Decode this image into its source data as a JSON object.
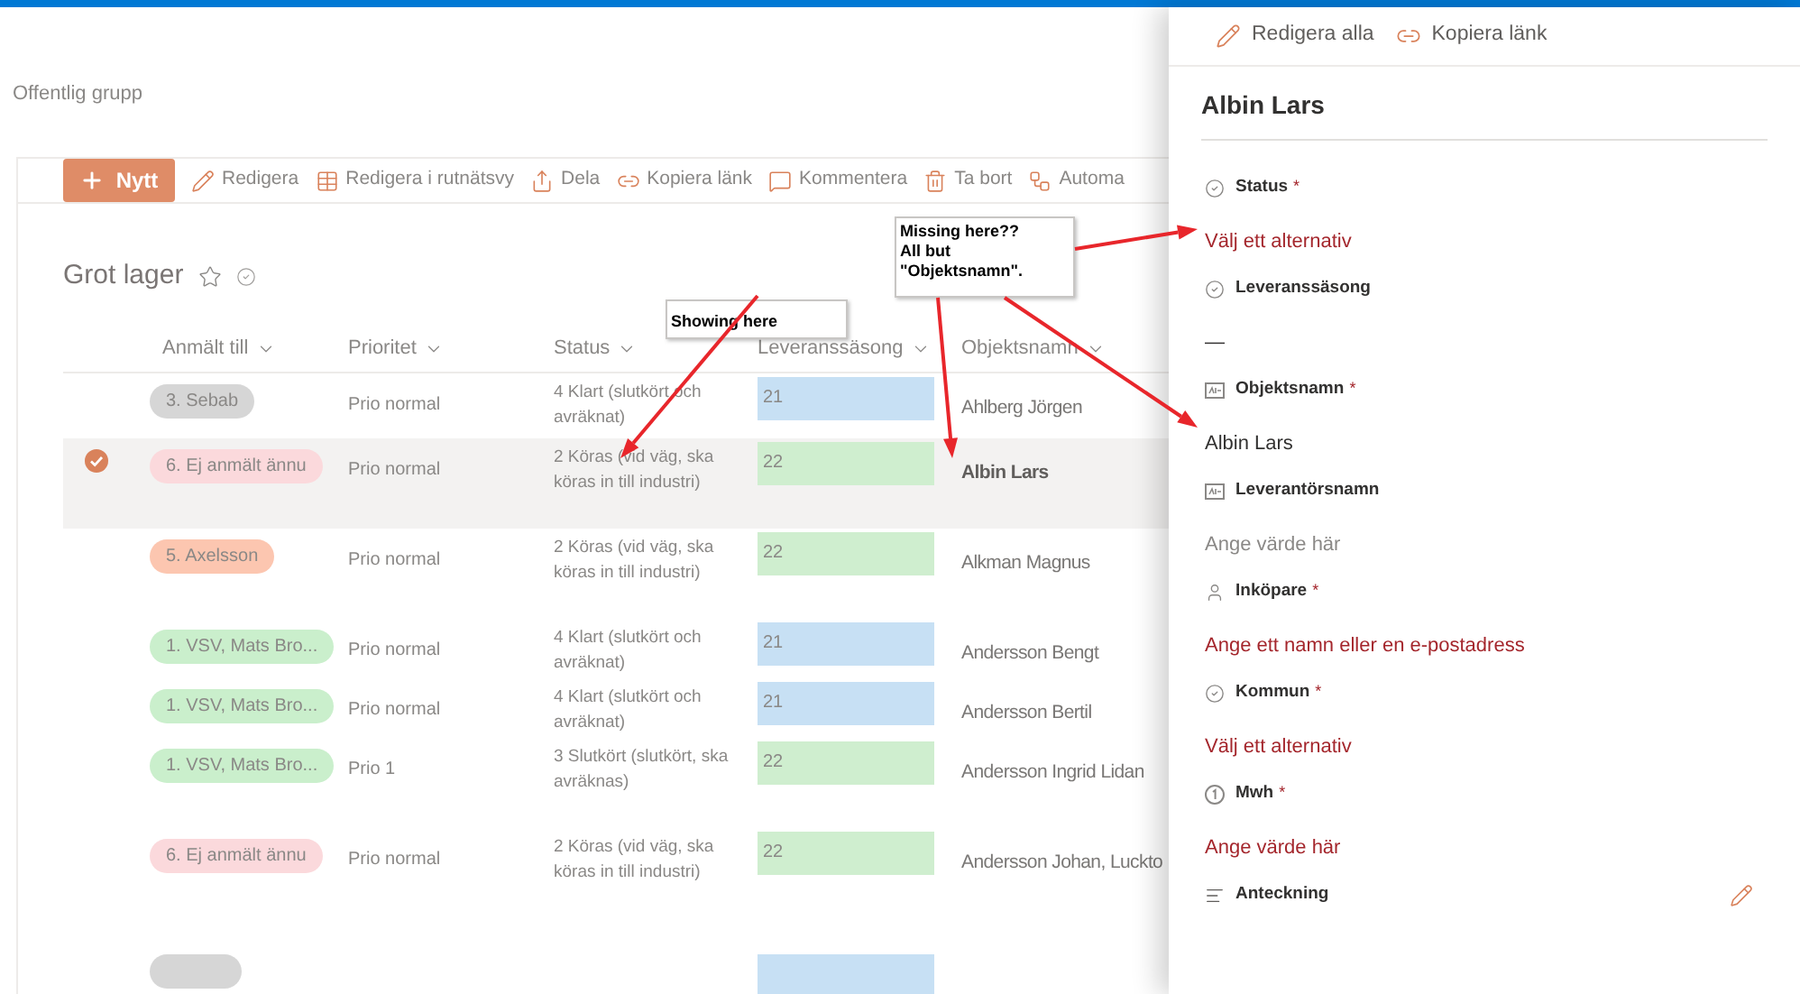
{
  "header": {
    "group_label": "Offentlig grupp"
  },
  "toolbar": {
    "new_button": {
      "label": "Nytt"
    },
    "items": [
      {
        "label": "Redigera",
        "kind": "pencil"
      },
      {
        "label": "Redigera i rutnätsvy",
        "kind": "grid"
      },
      {
        "label": "Dela",
        "kind": "share"
      },
      {
        "label": "Kopiera länk",
        "kind": "link"
      },
      {
        "label": "Kommentera",
        "kind": "comment"
      },
      {
        "label": "Ta bort",
        "kind": "trash"
      },
      {
        "label": "Automa",
        "kind": "flow"
      }
    ]
  },
  "list": {
    "title": "Grot lager",
    "columns": [
      "Anmält till",
      "Prioritet",
      "Status",
      "Leveranssäsong",
      "Objektsnamn"
    ],
    "rows": [
      {
        "selected": false,
        "assignee": {
          "label": "3. Sebab",
          "color": "#d6d6d6"
        },
        "priority": "Prio normal",
        "status": "4 Klart (slutkört och avräknat)",
        "season": {
          "label": "21",
          "color": "#c7e0f4"
        },
        "name": "Ahlberg Jörgen"
      },
      {
        "selected": true,
        "assignee": {
          "label": "6. Ej anmält ännu",
          "color": "#fbd9dc"
        },
        "priority": "Prio normal",
        "status": "2 Köras (vid väg, ska köras in till industri)",
        "season": {
          "label": "22",
          "color": "#cfeecf"
        },
        "name": "Albin Lars"
      },
      {
        "selected": false,
        "assignee": {
          "label": "5. Axelsson",
          "color": "#fcc6b0"
        },
        "priority": "Prio normal",
        "status": "2 Köras (vid väg, ska köras in till industri)",
        "season": {
          "label": "22",
          "color": "#cfeecf"
        },
        "name": "Alkman Magnus"
      },
      {
        "selected": false,
        "assignee": {
          "label": "1. VSV, Mats Bro...",
          "color": "#caefcc"
        },
        "priority": "Prio normal",
        "status": "4 Klart (slutkört och avräknat)",
        "season": {
          "label": "21",
          "color": "#c7e0f4"
        },
        "name": "Andersson Bengt"
      },
      {
        "selected": false,
        "assignee": {
          "label": "1. VSV, Mats Bro...",
          "color": "#caefcc"
        },
        "priority": "Prio normal",
        "status": "4 Klart (slutkört och avräknat)",
        "season": {
          "label": "21",
          "color": "#c7e0f4"
        },
        "name": "Andersson Bertil"
      },
      {
        "selected": false,
        "assignee": {
          "label": "1. VSV, Mats Bro...",
          "color": "#caefcc"
        },
        "priority": "Prio 1",
        "status": "3 Slutkört (slutkört, ska avräknas)",
        "season": {
          "label": "22",
          "color": "#cfeecf"
        },
        "name": "Andersson Ingrid Lidan"
      },
      {
        "selected": false,
        "assignee": {
          "label": "6. Ej anmält ännu",
          "color": "#fbd9dc"
        },
        "priority": "Prio normal",
        "status": "2 Köras (vid väg, ska köras in till industri)",
        "season": {
          "label": "22",
          "color": "#cfeecf"
        },
        "name": "Andersson Johan, Luckto"
      },
      {
        "selected": false,
        "assignee": {
          "color": "#d6d6d6"
        },
        "season": {
          "color": "#c7e0f4"
        }
      }
    ]
  },
  "panel": {
    "actions": [
      {
        "label": "Redigera alla",
        "kind": "pencil"
      },
      {
        "label": "Kopiera länk",
        "kind": "link"
      }
    ],
    "title": "Albin Lars",
    "fields": [
      {
        "label": "Status",
        "required_mark": "*",
        "kind": "choice",
        "placeholder": "Välj ett alternativ"
      },
      {
        "label": "Leveranssäsong",
        "kind": "choice",
        "value": "—"
      },
      {
        "label": "Objektsnamn",
        "required_mark": "*",
        "kind": "text",
        "value": "Albin Lars"
      },
      {
        "label": "Leverantörsnamn",
        "kind": "text",
        "placeholder": "Ange värde här"
      },
      {
        "label": "Inköpare",
        "required_mark": "*",
        "kind": "person",
        "placeholder": "Ange ett namn eller en e-postadress"
      },
      {
        "label": "Kommun",
        "required_mark": "*",
        "kind": "choice",
        "placeholder": "Välj ett alternativ"
      },
      {
        "label": "Mwh",
        "required_mark": "*",
        "kind": "number",
        "placeholder": "Ange värde här"
      },
      {
        "label": "Anteckning",
        "kind": "note",
        "editable": true
      }
    ]
  },
  "annotations": [
    {
      "text": "Missing here??\nAll but\n\"Objektsnamn\"."
    },
    {
      "text": "Showing here"
    }
  ]
}
